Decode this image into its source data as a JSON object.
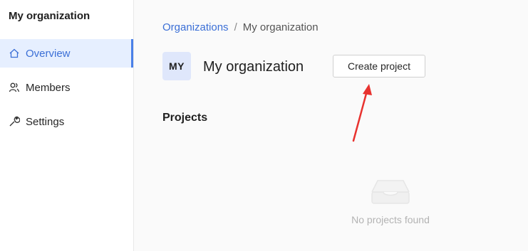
{
  "sidebar": {
    "title": "My organization",
    "items": [
      {
        "label": "Overview",
        "icon": "home-icon",
        "active": true
      },
      {
        "label": "Members",
        "icon": "members-icon",
        "active": false
      },
      {
        "label": "Settings",
        "icon": "wrench-icon",
        "active": false
      }
    ]
  },
  "breadcrumb": {
    "parent": "Organizations",
    "separator": "/",
    "current": "My organization"
  },
  "header": {
    "avatar_initials": "MY",
    "title": "My organization",
    "create_button_label": "Create project"
  },
  "projects": {
    "section_title": "Projects",
    "empty_icon": "inbox-icon",
    "empty_text": "No projects found"
  },
  "annotation": {
    "arrow_color": "#e8322f"
  },
  "colors": {
    "accent": "#3b6fd6",
    "active_bg": "#e6efff",
    "avatar_bg": "#dfe7fb"
  }
}
